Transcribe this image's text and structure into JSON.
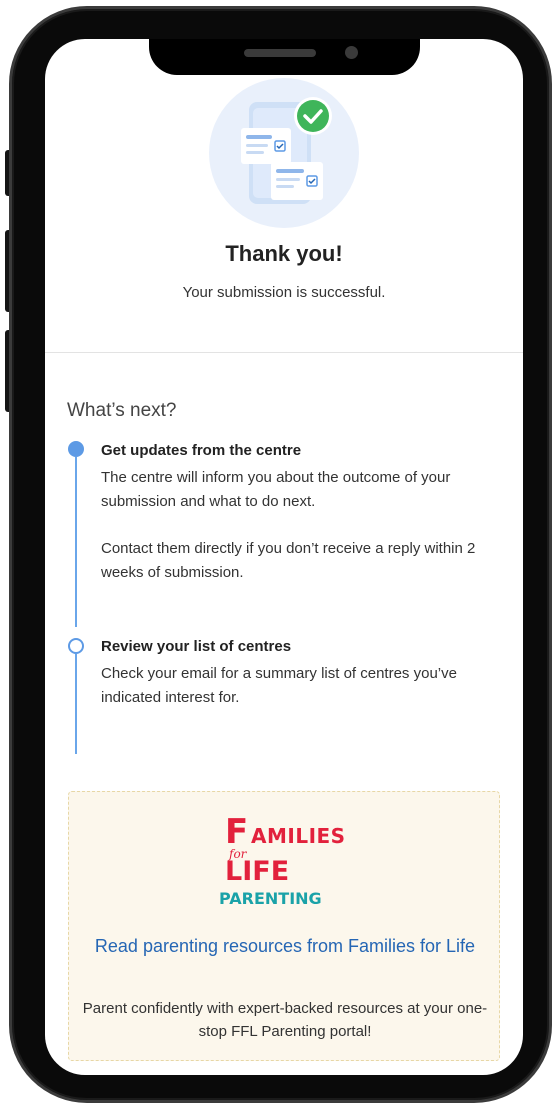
{
  "confirmation": {
    "title": "Thank you!",
    "subtitle": "Your submission is successful."
  },
  "next_steps": {
    "heading": "What’s next?",
    "steps": [
      {
        "title": "Get updates from the centre",
        "text": "The centre will inform you about the outcome of your submission and what to do next.",
        "text2": "Contact them directly if you don’t receive a reply within 2 weeks of submission.",
        "status": "active"
      },
      {
        "title": "Review your list of centres",
        "text": "Check your email for a summary list of centres you’ve indicated interest for.",
        "status": "pending"
      }
    ]
  },
  "ffl_card": {
    "logo": {
      "initial": "F",
      "word1_rest": "AMILIES",
      "connector": "for",
      "word2": "LIFE",
      "tagline": "PARENTING"
    },
    "link_text": "Read parenting resources from Families for Life",
    "description": "Parent confidently with expert-backed resources at your one-stop FFL Parenting portal!"
  },
  "colors": {
    "accent_blue": "#5d9ae5",
    "link_blue": "#2566b4",
    "success_green": "#3fb55a",
    "ffl_red": "#e2213c",
    "ffl_teal": "#1aa2a8",
    "card_bg": "#fcf7ec"
  },
  "icons": {
    "illustration": "form-checked-illustration",
    "success": "check-circle-icon"
  }
}
